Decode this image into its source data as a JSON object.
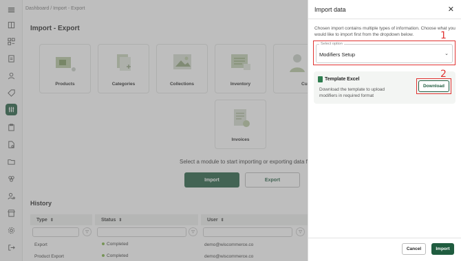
{
  "breadcrumb": {
    "home": "Dashboard",
    "separator": "/",
    "current": "Import - Export"
  },
  "page": {
    "title": "Import - Export"
  },
  "modules": [
    {
      "label": "Products",
      "icon": "products-icon"
    },
    {
      "label": "Categories",
      "icon": "categories-icon"
    },
    {
      "label": "Collections",
      "icon": "collections-icon"
    },
    {
      "label": "Inventory",
      "icon": "inventory-icon"
    },
    {
      "label": "Custome",
      "icon": "customers-icon"
    },
    {
      "label": "Invoices",
      "icon": "invoices-icon"
    }
  ],
  "select_message": "Select a module to start importing or exporting data for",
  "actions": {
    "import_label": "Import",
    "export_label": "Export"
  },
  "history": {
    "title": "History",
    "columns": [
      "Type",
      "Status",
      "User"
    ],
    "rows": [
      {
        "type": "Export",
        "status": "Completed",
        "user": "demo@wiscommerce.co"
      },
      {
        "type": "Product Export",
        "status": "Completed",
        "user": "demo@wiscommerce.co"
      }
    ]
  },
  "panel": {
    "title": "Import data",
    "description": "Chosen import contains multiple types of information. Choose what you would like to import first from the dropdown below.",
    "select_label": "Select option",
    "select_value": "Modifiers Setup",
    "template_title": "Template Excel",
    "template_desc": "Download the template to upload modifiers in required format",
    "download_label": "Download",
    "cancel_label": "Cancel",
    "import_label": "Import"
  },
  "annotations": {
    "one": "1",
    "two": "2"
  },
  "colors": {
    "brand": "#1f5c3f",
    "annotation": "#e0312f",
    "status_completed": "#7cb342"
  }
}
